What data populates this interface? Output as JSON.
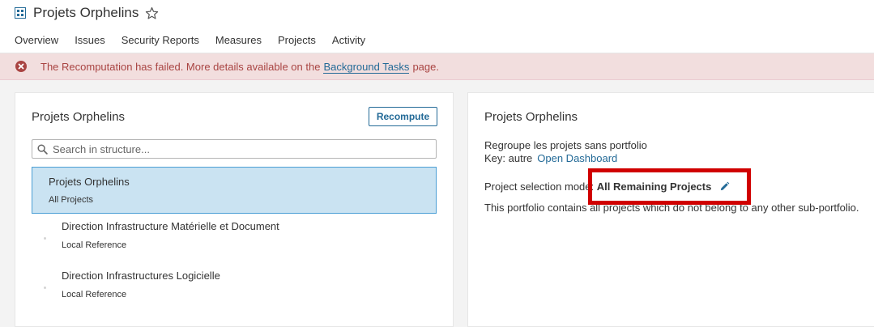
{
  "header": {
    "title": "Projets Orphelins",
    "nav": [
      "Overview",
      "Issues",
      "Security Reports",
      "Measures",
      "Projects",
      "Activity"
    ]
  },
  "alert": {
    "text_before": "The Recomputation has failed. More details available on the",
    "link": "Background Tasks",
    "text_after": "page."
  },
  "structure": {
    "title": "Projets Orphelins",
    "recompute_label": "Recompute",
    "search_placeholder": "Search in structure...",
    "items": [
      {
        "name": "Projets Orphelins",
        "sub": "All Projects"
      },
      {
        "name": "Direction Infrastructure Matérielle et Document",
        "sub": "Local Reference"
      },
      {
        "name": "Direction Infrastructures Logicielle",
        "sub": "Local Reference"
      }
    ]
  },
  "details": {
    "title": "Projets Orphelins",
    "description": "Regroupe les projets sans portfolio",
    "key_label": "Key: autre",
    "open_dashboard": "Open Dashboard",
    "mode_label": "Project selection mode:",
    "mode_value": "All Remaining Projects",
    "explanation": "This portfolio contains all projects which do not belong to any other sub-portfolio."
  },
  "colors": {
    "accent": "#236a97",
    "error": "#a94442",
    "highlight": "#d00000",
    "selected": "#cae3f2"
  }
}
